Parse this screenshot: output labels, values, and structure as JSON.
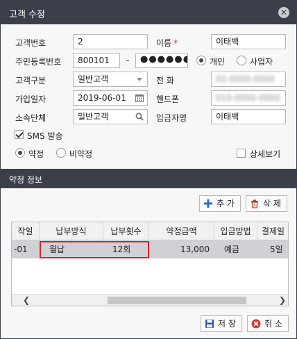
{
  "window": {
    "title": "고객 수정",
    "close_symbol": "✕"
  },
  "form": {
    "customer_no": {
      "label": "고객번호",
      "value": "2"
    },
    "name": {
      "label": "이름",
      "required_mark": "*",
      "value": "이태백"
    },
    "resident_no": {
      "label": "주민등록번호",
      "front": "800101",
      "separator": "-",
      "back_masked": "●●●●●●"
    },
    "person_type": {
      "options": [
        "개인",
        "사업자"
      ],
      "selected": "개인"
    },
    "customer_type": {
      "label": "고객구분",
      "value": "일반고객"
    },
    "phone": {
      "label": "전 화",
      "value": "02-0000-0000"
    },
    "join_date": {
      "label": "가입일자",
      "value": "2019-06-01"
    },
    "mobile": {
      "label": "핸드폰",
      "value": "010-0000-0000"
    },
    "group": {
      "label": "소속단체",
      "value": "일반고객"
    },
    "depositor": {
      "label": "입금자명",
      "value": "이태백"
    },
    "sms": {
      "label": "SMS 발송",
      "checked": true
    },
    "contract_type": {
      "options": [
        "약정",
        "비약정"
      ],
      "selected": "약정"
    },
    "detail_view": {
      "label": "상세보기",
      "checked": false
    }
  },
  "section": {
    "title": "약정 정보"
  },
  "actions": {
    "add_label": "추 가",
    "delete_label": "삭 제"
  },
  "table": {
    "columns": [
      "작일",
      "납부방식",
      "납부횟수",
      "약정금액",
      "입금방법",
      "결제일"
    ],
    "rows": [
      {
        "start": "-01",
        "method": "월납",
        "count": "12회",
        "amount": "13,000",
        "deposit": "예금",
        "pay_day": "5일"
      }
    ]
  },
  "footer": {
    "save_label": "저 장",
    "cancel_label": "취 소"
  },
  "colors": {
    "header_bg": "#3b3f4a",
    "highlight_border": "#e02020",
    "required": "#dd2222"
  }
}
